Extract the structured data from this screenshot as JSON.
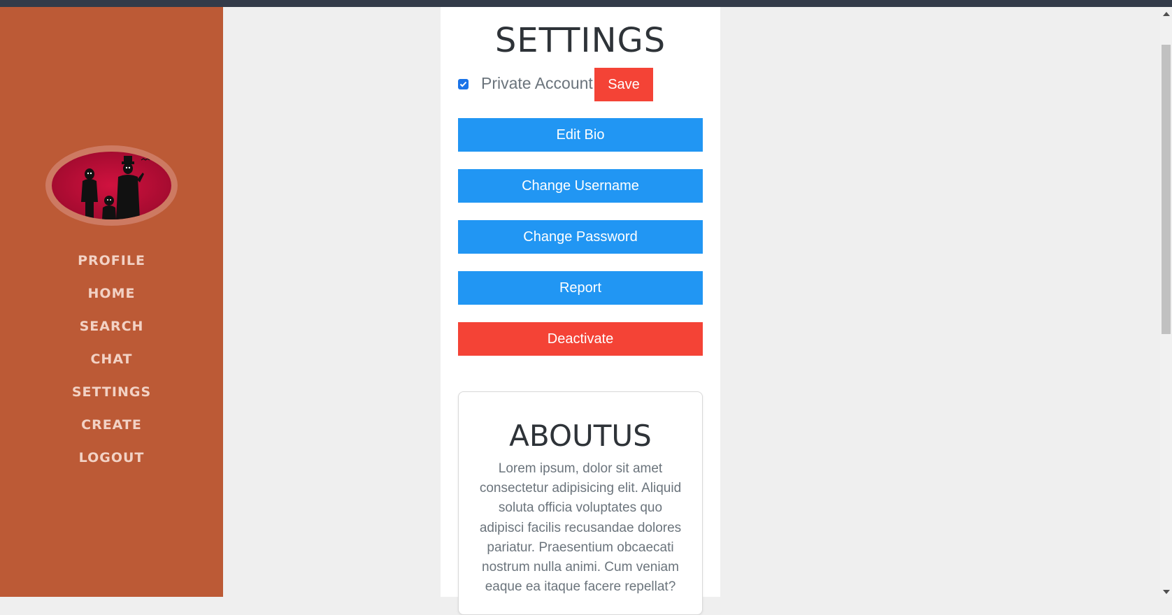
{
  "sidebar": {
    "logo_icon": "family-silhouette-logo",
    "items": [
      {
        "label": "PROFILE"
      },
      {
        "label": "HOME"
      },
      {
        "label": "SEARCH"
      },
      {
        "label": "CHAT"
      },
      {
        "label": "SETTINGS"
      },
      {
        "label": "CREATE"
      },
      {
        "label": "LOGOUT"
      }
    ]
  },
  "settings": {
    "title": "SETTINGS",
    "private_account_label": "Private Account",
    "private_account_checked": true,
    "save_label": "Save",
    "buttons": {
      "edit_bio": "Edit Bio",
      "change_username": "Change Username",
      "change_password": "Change Password",
      "report": "Report",
      "deactivate": "Deactivate"
    }
  },
  "about": {
    "title": "ABOUTUS",
    "text": "Lorem ipsum, dolor sit amet consectetur adipisicing elit. Aliquid soluta officia voluptates quo adipisci facilis recusandae dolores pariatur. Praesentium obcaecati nostrum nulla animi. Cum veniam eaque ea itaque facere repellat?"
  },
  "colors": {
    "sidebar_bg": "#bc5a36",
    "nav_text": "#f2d2c5",
    "primary_blue": "#2196f3",
    "danger_red": "#f44336",
    "page_bg": "#efefef",
    "topbar": "#333b49"
  }
}
